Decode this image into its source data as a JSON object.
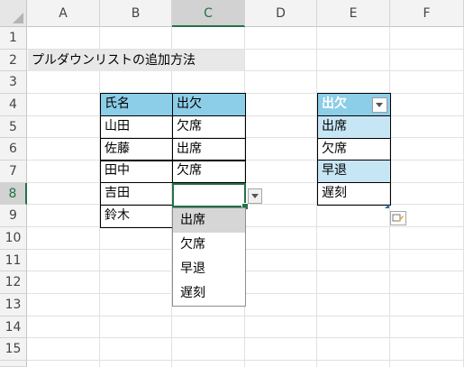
{
  "columns": [
    "A",
    "B",
    "C",
    "D",
    "E",
    "F"
  ],
  "rows": [
    "1",
    "2",
    "3",
    "4",
    "5",
    "6",
    "7",
    "8",
    "9",
    "10",
    "11",
    "12",
    "13",
    "14",
    "15"
  ],
  "title": "プルダウンリストの追加方法",
  "left_table": {
    "headers": [
      "氏名",
      "出欠"
    ],
    "rows": [
      [
        "山田",
        "欠席"
      ],
      [
        "佐藤",
        "出席"
      ],
      [
        "田中",
        "欠席"
      ],
      [
        "吉田",
        ""
      ],
      [
        "鈴木",
        ""
      ]
    ]
  },
  "right_table": {
    "header": "出欠",
    "items": [
      "出席",
      "欠席",
      "早退",
      "遅刻"
    ]
  },
  "dropdown": {
    "items": [
      "出席",
      "欠席",
      "早退",
      "遅刻"
    ],
    "highlighted": "出席"
  },
  "colors": {
    "header_blue": "#8ccde8",
    "band_light": "#c7e6f5",
    "selection_green": "#217346"
  },
  "icons": {
    "filter": "chevron-down-icon",
    "smart_tag": "quick-analysis-icon"
  }
}
